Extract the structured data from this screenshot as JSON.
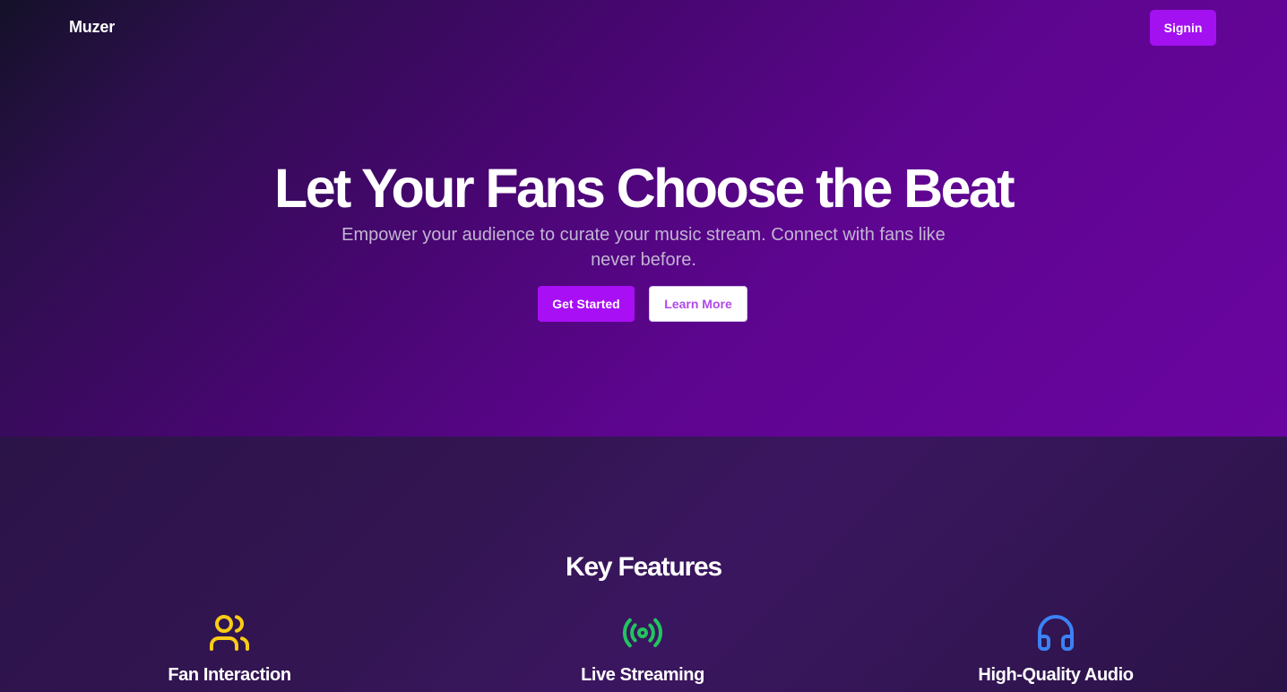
{
  "navbar": {
    "brand": "Muzer",
    "signin_label": "Signin"
  },
  "hero": {
    "title": "Let Your Fans Choose the Beat",
    "subtitle": "Empower your audience to curate your music stream. Connect with fans like never before.",
    "primary_button": "Get Started",
    "secondary_button": "Learn More"
  },
  "features": {
    "title": "Key Features",
    "items": [
      {
        "label": "Fan Interaction",
        "icon": "users-icon",
        "color": "#facc15"
      },
      {
        "label": "Live Streaming",
        "icon": "radio-icon",
        "color": "#22c55e"
      },
      {
        "label": "High-Quality Audio",
        "icon": "headphones-icon",
        "color": "#3b82f6"
      }
    ]
  },
  "colors": {
    "accent": "#a80ff5",
    "hero_gradient_end": "#6a05a0"
  }
}
